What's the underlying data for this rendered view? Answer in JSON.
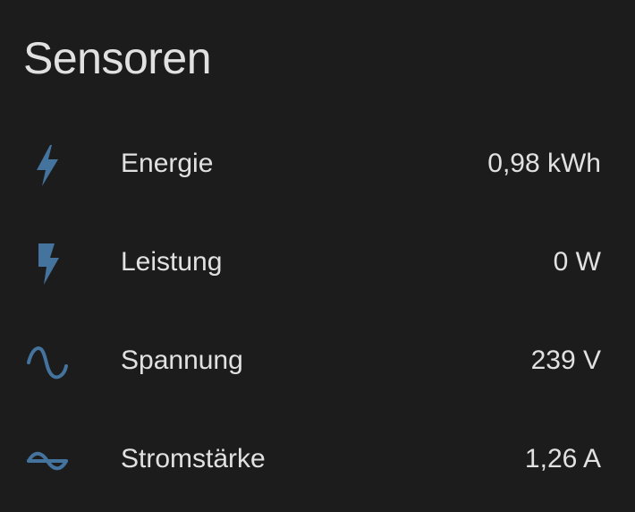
{
  "card": {
    "title": "Sensoren"
  },
  "accent_color": "#44739e",
  "sensors": [
    {
      "icon": "flash-icon",
      "label": "Energie",
      "value": "0,98 kWh"
    },
    {
      "icon": "flash-filled-icon",
      "label": "Leistung",
      "value": "0 W"
    },
    {
      "icon": "sine-wave-icon",
      "label": "Spannung",
      "value": "239 V"
    },
    {
      "icon": "current-ac-icon",
      "label": "Stromstärke",
      "value": "1,26 A"
    }
  ]
}
